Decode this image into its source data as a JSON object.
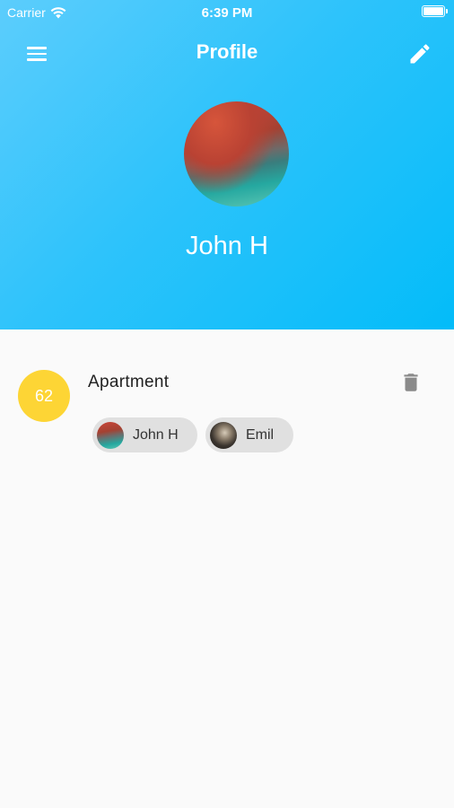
{
  "status_bar": {
    "carrier": "Carrier",
    "time": "6:39 PM"
  },
  "header": {
    "title": "Profile",
    "menu_icon": "menu-icon",
    "edit_icon": "pencil-icon",
    "user_name": "John H",
    "avatar_icon": "profile-photo"
  },
  "colors": {
    "header_start": "#5ccdfc",
    "header_end": "#03bcf9",
    "badge": "#fdd535",
    "chip_bg": "#e0e0e0"
  },
  "items": [
    {
      "score": "62",
      "title": "Apartment",
      "delete_icon": "trash-icon",
      "members": [
        {
          "name": "John H"
        },
        {
          "name": "Emil"
        }
      ]
    }
  ]
}
